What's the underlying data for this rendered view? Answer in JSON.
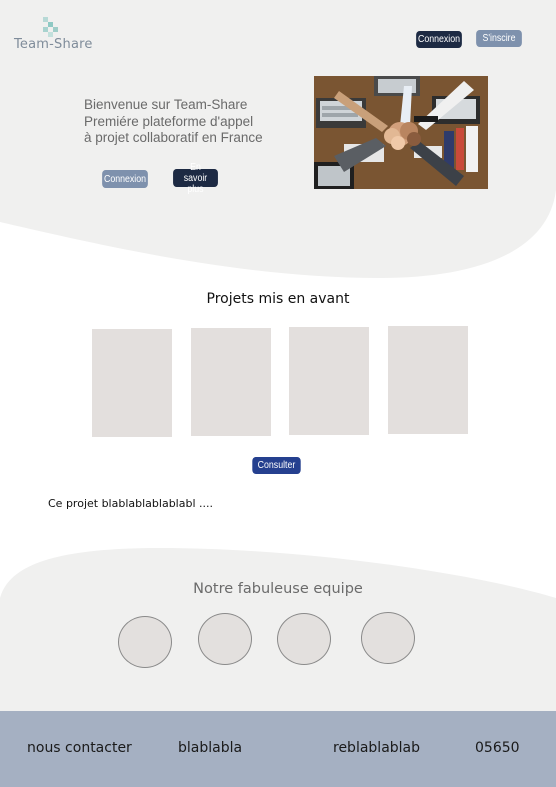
{
  "brand": {
    "name": "Team-Share"
  },
  "header": {
    "login_label": "Connexion",
    "signup_label": "S'inscire"
  },
  "hero": {
    "lines": [
      "Bienvenue sur Team-Share",
      "Premiére plateforme d'appel",
      "à projet collaboratif en France"
    ],
    "login_label": "Connexion",
    "more_label": "En savoir plus"
  },
  "featured": {
    "title": "Projets mis en avant",
    "consult_label": "Consulter",
    "description": "Ce projet blablablablablabl ...."
  },
  "team": {
    "title": "Notre fabuleuse equipe"
  },
  "footer": {
    "items": [
      "nous contacter",
      "blablabla",
      "reblablablab",
      "05650"
    ]
  },
  "colors": {
    "hero_bg": "#f0f0ef",
    "dark_button": "#1d2a43",
    "light_button": "#7e91ad",
    "consult_button": "#25408f",
    "card": "#e3dfdd",
    "footer_bg": "#a5b0c2"
  }
}
